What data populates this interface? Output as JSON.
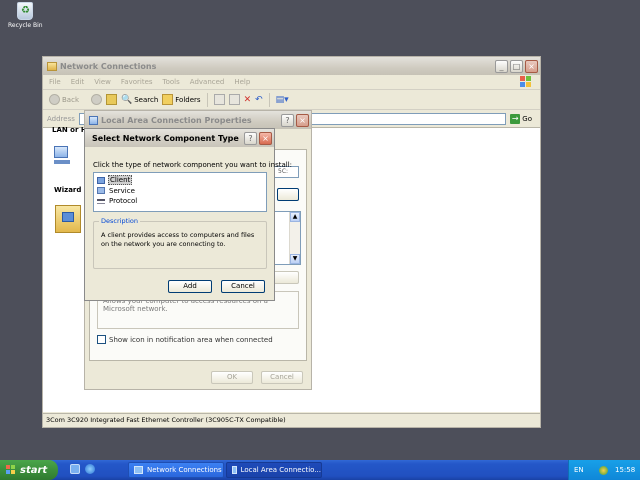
{
  "desktop": {
    "recycle_bin_label": "Recycle Bin"
  },
  "network_connections": {
    "title": "Network Connections",
    "menu": [
      "File",
      "Edit",
      "View",
      "Favorites",
      "Tools",
      "Advanced",
      "Help"
    ],
    "toolbar": {
      "back": "Back",
      "search": "Search",
      "folders": "Folders"
    },
    "address_label": "Address",
    "go_label": "Go",
    "left_label": "LAN or H",
    "wizard_label": "Wizard",
    "status_bar": "3Com 3C920 Integrated Fast Ethernet Controller (3C905C-TX Compatible)"
  },
  "lac_properties": {
    "title": "Local Area Connection Properties",
    "field_fragment": "5C:",
    "desc_text": "Allows your computer to access resources on a Microsoft network.",
    "show_icon_label": "Show icon in notification area when connected",
    "ok_label": "OK",
    "cancel_label": "Cancel"
  },
  "select_component": {
    "title": "Select Network Component Type",
    "prompt": "Click the type of network component you want to install:",
    "items": [
      {
        "label": "Client",
        "icon": "client-icon",
        "selected": true
      },
      {
        "label": "Service",
        "icon": "service-icon",
        "selected": false
      },
      {
        "label": "Protocol",
        "icon": "protocol-icon",
        "selected": false
      }
    ],
    "description_label": "Description",
    "description_text": "A client provides access to computers and files on the network you are connecting to.",
    "add_label": "Add",
    "cancel_label": "Cancel"
  },
  "taskbar": {
    "start_label": "start",
    "tasks": [
      {
        "label": "Network Connections",
        "active": false
      },
      {
        "label": "Local Area Connectio...",
        "active": true
      }
    ],
    "language": "EN",
    "clock": "15:58"
  },
  "colors": {
    "desktop": "#4d4f5a",
    "taskbar": "#2457c8",
    "start": "#3c8f3c",
    "tray": "#0f87d8"
  }
}
